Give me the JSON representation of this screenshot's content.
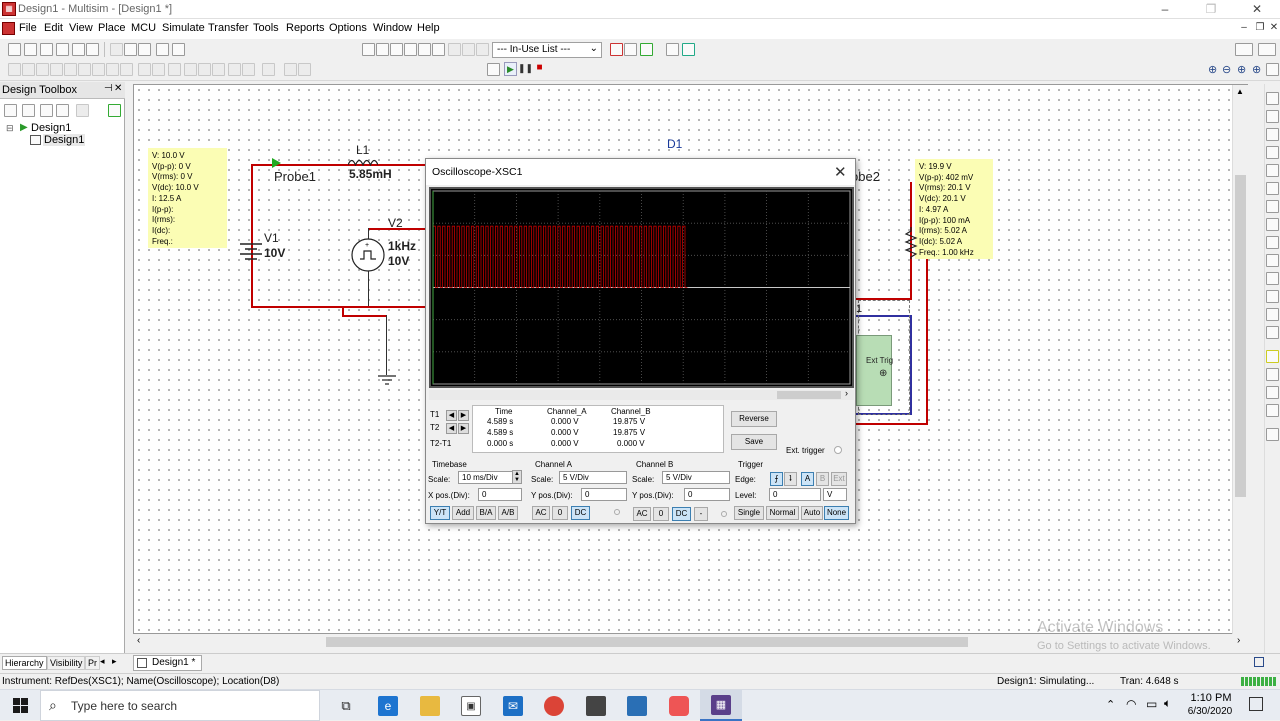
{
  "window": {
    "title": "Design1 - Multisim - [Design1 *]",
    "controls": [
      "–",
      "❐",
      "✕"
    ]
  },
  "menu": [
    "File",
    "Edit",
    "View",
    "Place",
    "MCU",
    "Simulate",
    "Transfer",
    "Tools",
    "Reports",
    "Options",
    "Window",
    "Help"
  ],
  "toolbar": {
    "inuse_list": "--- In-Use List ---"
  },
  "design_toolbox": {
    "title": "Design Toolbox",
    "tree": [
      {
        "label": "Design1",
        "level": 0
      },
      {
        "label": "Design1",
        "level": 1
      }
    ],
    "tabs": [
      "Hierarchy",
      "Visibility",
      "Pr"
    ]
  },
  "circuit": {
    "probe1": {
      "label": "Probe1",
      "readings": [
        "V: 10.0 V",
        "V(p-p): 0 V",
        "V(rms): 0 V",
        "V(dc): 10.0 V",
        "I: 12.5 A",
        "I(p-p):",
        "I(rms):",
        "I(dc):",
        "Freq.:"
      ]
    },
    "probe2": {
      "label": "obe2",
      "readings": [
        "V: 19.9 V",
        "V(p-p): 402 mV",
        "V(rms): 20.1 V",
        "V(dc): 20.1 V",
        "I: 4.97 A",
        "I(p-p): 100 mA",
        "I(rms): 5.02 A",
        "I(dc): 5.02 A",
        "Freq.: 1.00 kHz"
      ]
    },
    "inductor": {
      "ref": "L1",
      "value": "5.85mH"
    },
    "diode": {
      "ref": "D1"
    },
    "dc_source": {
      "ref": "V1",
      "value": "10V"
    },
    "pulse_source": {
      "ref": "V2",
      "freq": "1kHz",
      "value": "10V"
    },
    "scope_symbol": {
      "label": "Ext Trig",
      "ref_fragment": "1"
    }
  },
  "oscilloscope": {
    "title": "Oscilloscope-XSC1",
    "cursor_table": {
      "headers": [
        "Time",
        "Channel_A",
        "Channel_B"
      ],
      "rows": [
        {
          "label": "T1",
          "time": "4.589 s",
          "a": "0.000 V",
          "b": "19.875 V"
        },
        {
          "label": "T2",
          "time": "4.589 s",
          "a": "0.000 V",
          "b": "19.875 V"
        },
        {
          "label": "T2-T1",
          "time": "0.000 s",
          "a": "0.000 V",
          "b": "0.000 V"
        }
      ]
    },
    "reverse_label": "Reverse",
    "save_label": "Save",
    "ext_trigger_label": "Ext. trigger",
    "timebase": {
      "title": "Timebase",
      "scale_label": "Scale:",
      "scale": "10 ms/Div",
      "xpos_label": "X pos.(Div):",
      "xpos": "0",
      "modes": [
        "Y/T",
        "Add",
        "B/A",
        "A/B"
      ]
    },
    "channel_a": {
      "title": "Channel A",
      "scale_label": "Scale:",
      "scale": "5  V/Div",
      "ypos_label": "Y pos.(Div):",
      "ypos": "0",
      "coupling": [
        "AC",
        "0",
        "DC"
      ]
    },
    "channel_b": {
      "title": "Channel B",
      "scale_label": "Scale:",
      "scale": "5  V/Div",
      "ypos_label": "Y pos.(Div):",
      "ypos": "0",
      "coupling": [
        "AC",
        "0",
        "DC",
        "-"
      ]
    },
    "trigger": {
      "title": "Trigger",
      "edge_label": "Edge:",
      "level_label": "Level:",
      "level": "0",
      "level_unit": "V",
      "source_buttons": [
        "A",
        "B",
        "Ext"
      ],
      "modes": [
        "Single",
        "Normal",
        "Auto",
        "None"
      ]
    },
    "colors": {
      "channel_b_trace": "#c00000",
      "grid": "#5a5a5a"
    }
  },
  "bottom_tab": "Design1 *",
  "status": {
    "instrument": "Instrument: RefDes(XSC1); Name(Oscilloscope); Location(D8)",
    "sim_state": "Design1: Simulating...",
    "tran": "Tran: 4.648 s"
  },
  "watermark": {
    "line1": "Activate Windows",
    "line2": "Go to Settings to activate Windows."
  },
  "taskbar": {
    "search_placeholder": "Type here to search",
    "time": "1:10 PM",
    "date": "6/30/2020"
  }
}
